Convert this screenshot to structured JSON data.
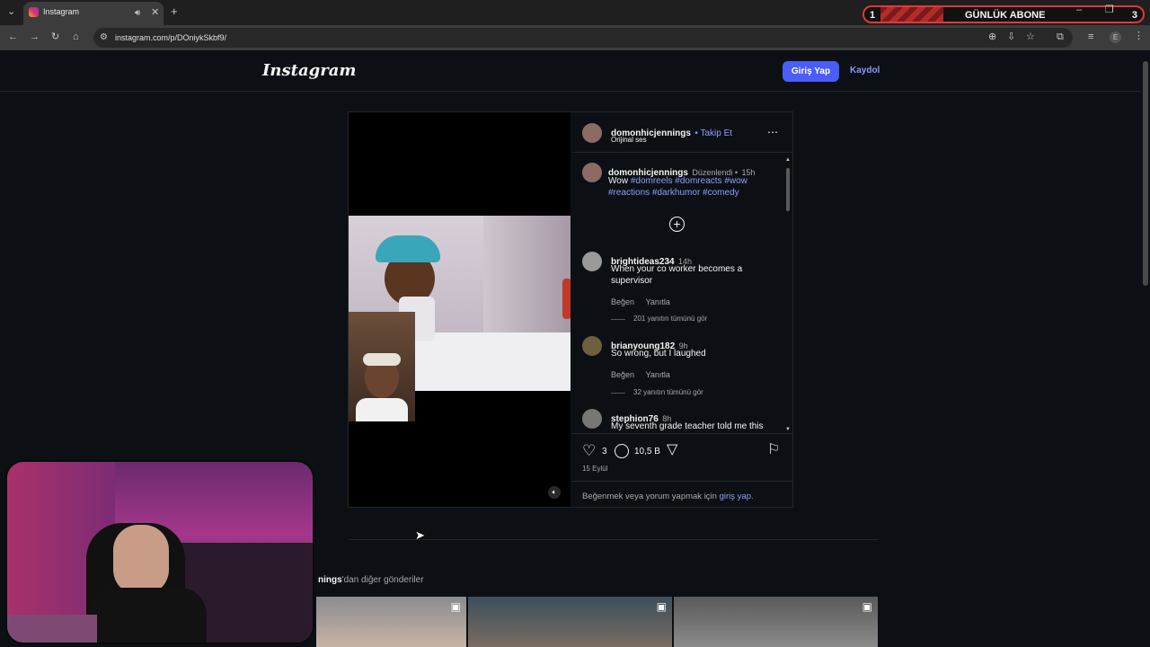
{
  "browser": {
    "tab_title": "Instagram",
    "url": "instagram.com/p/DOniykSkbf9/",
    "profile_initial": "E"
  },
  "overlay": {
    "left_number": "1",
    "label": "GÜNLÜK ABONE",
    "right_number": "3"
  },
  "header": {
    "logo": "Instagram",
    "login_label": "Giriş Yap",
    "signup_label": "Kaydol"
  },
  "post": {
    "author": "domonhicjennings",
    "follow_label": "• Takip Et",
    "audio": "Orijinal ses",
    "caption": {
      "author": "domonhicjennings",
      "edited": "Düzenlendi •",
      "time": "15h",
      "text_lead": "Wow",
      "hashtags_line1": "#domreels #domreacts #wow",
      "hashtags_line2": "#reactions #darkhumor #comedy"
    },
    "comments": [
      {
        "user": "brightideas234",
        "time": "14h",
        "text": "When your co worker becomes a supervisor",
        "like": "Beğen",
        "reply": "Yanıtla",
        "replies": "201 yanıtın tümünü gör"
      },
      {
        "user": "brianyoung182",
        "time": "9h",
        "text": "So wrong, but I laughed",
        "like": "Beğen",
        "reply": "Yanıtla",
        "replies": "32 yanıtın tümünü gör"
      },
      {
        "user": "stephion76",
        "time": "8h",
        "text": "My seventh grade teacher told me this"
      }
    ],
    "like_count": "3",
    "comment_count": "10,5 B",
    "date": "15 Eylül",
    "login_prompt": "Beğenmek veya yorum yapmak için",
    "login_link": "giriş yap."
  },
  "more_posts": {
    "label_bold": "nings",
    "label_rest": "'dan diğer gönderiler"
  },
  "colors": {
    "accent": "#4a5df9",
    "link": "#8f9dff",
    "background": "#0c1014"
  }
}
